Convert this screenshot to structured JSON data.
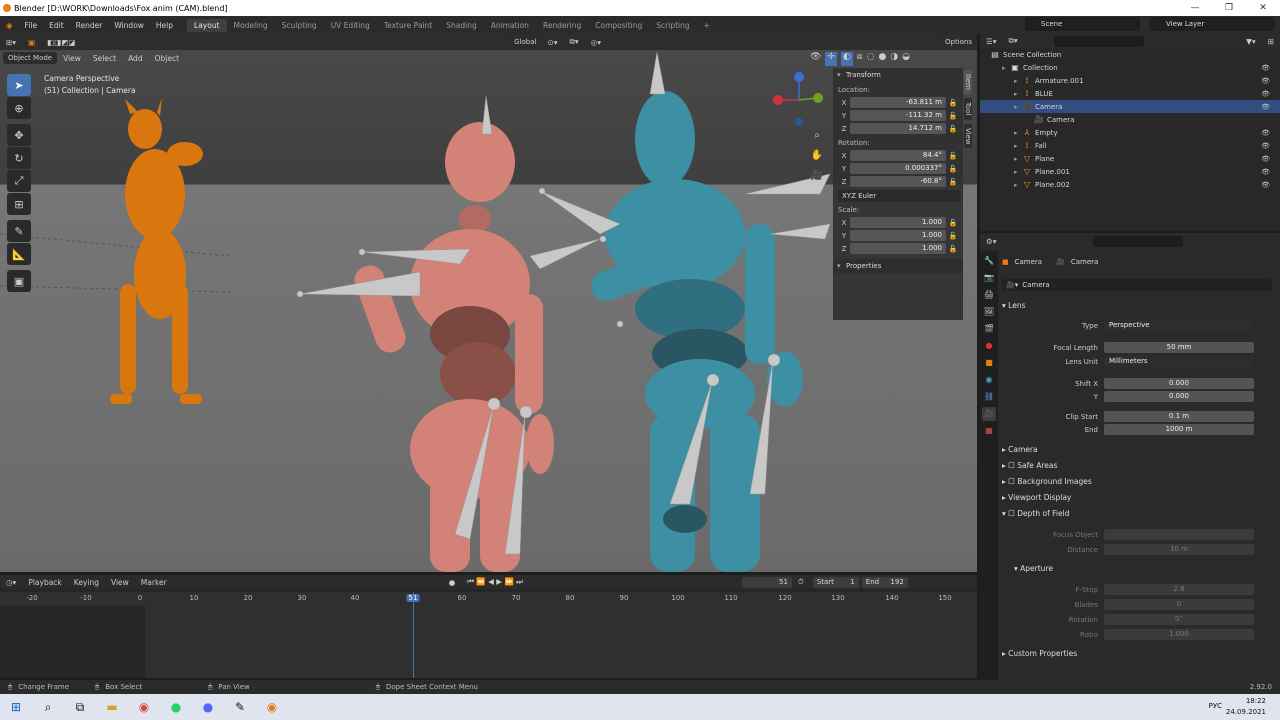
{
  "window": {
    "title": "Blender [D:\\WORK\\Downloads\\Fox anim (CAM).blend]"
  },
  "menu": {
    "file": "File",
    "edit": "Edit",
    "render": "Render",
    "window": "Window",
    "help": "Help"
  },
  "workspaces": [
    "Layout",
    "Modeling",
    "Sculpting",
    "UV Editing",
    "Texture Paint",
    "Shading",
    "Animation",
    "Rendering",
    "Compositing",
    "Scripting"
  ],
  "scene": "Scene",
  "view_layer": "View Layer",
  "viewport": {
    "mode": "Object Mode",
    "menus": [
      "View",
      "Select",
      "Add",
      "Object"
    ],
    "transform_orientation": "Global",
    "options": "Options",
    "info_line1": "Camera Perspective",
    "info_line2": "(51) Collection | Camera"
  },
  "npanel": {
    "transform": "Transform",
    "location_label": "Location:",
    "location": {
      "x": "-63.811 m",
      "y": "-111.32 m",
      "z": "14.712 m"
    },
    "rotation_label": "Rotation:",
    "rotation": {
      "x": "84.4°",
      "y": "0.000337°",
      "z": "-60.8°"
    },
    "rotation_mode": "XYZ Euler",
    "scale_label": "Scale:",
    "scale": {
      "x": "1.000",
      "y": "1.000",
      "z": "1.000"
    },
    "properties": "Properties",
    "tabs": [
      "Item",
      "Tool",
      "View"
    ]
  },
  "timeline": {
    "menus": [
      "Playback",
      "Keying",
      "View",
      "Marker"
    ],
    "current_frame": "51",
    "start_label": "Start",
    "start": "1",
    "end_label": "End",
    "end": "192",
    "ticks": [
      "-20",
      "-10",
      "0",
      "10",
      "20",
      "30",
      "40",
      "51",
      "60",
      "70",
      "80",
      "90",
      "100",
      "110",
      "120",
      "130",
      "140",
      "150"
    ]
  },
  "status": {
    "change_frame": "Change Frame",
    "box_select": "Box Select",
    "pan_view": "Pan View",
    "context_menu": "Dope Sheet Context Menu",
    "version": "2.92.0"
  },
  "outliner": {
    "scene_collection": "Scene Collection",
    "items": [
      {
        "name": "Collection",
        "icon": "collection-icon",
        "indent": 1
      },
      {
        "name": "Armature.001",
        "icon": "armature-icon",
        "indent": 2
      },
      {
        "name": "BLUE",
        "icon": "armature-icon",
        "indent": 2
      },
      {
        "name": "Camera",
        "icon": "camera-icon",
        "indent": 2,
        "selected": true
      },
      {
        "name": "Camera",
        "icon": "camera-data-icon",
        "indent": 3
      },
      {
        "name": "Empty",
        "icon": "empty-icon",
        "indent": 2
      },
      {
        "name": "Fall",
        "icon": "armature-icon",
        "indent": 2
      },
      {
        "name": "Plane",
        "icon": "mesh-icon",
        "indent": 2
      },
      {
        "name": "Plane.001",
        "icon": "mesh-icon",
        "indent": 2
      },
      {
        "name": "Plane.002",
        "icon": "mesh-icon",
        "indent": 2
      }
    ]
  },
  "properties": {
    "breadcrumb_object": "Camera",
    "breadcrumb_data": "Camera",
    "datablock": "Camera",
    "lens": "Lens",
    "type_label": "Type",
    "type": "Perspective",
    "focal_label": "Focal Length",
    "focal": "50 mm",
    "lens_unit_label": "Lens Unit",
    "lens_unit": "Millimeters",
    "shift_x_label": "Shift X",
    "shift_x": "0.000",
    "shift_y_label": "Y",
    "shift_y": "0.000",
    "clip_start_label": "Clip Start",
    "clip_start": "0.1 m",
    "clip_end_label": "End",
    "clip_end": "1000 m",
    "camera": "Camera",
    "safe_areas": "Safe Areas",
    "background_images": "Background Images",
    "viewport_display": "Viewport Display",
    "dof": "Depth of Field",
    "focus_object_label": "Focus Object",
    "distance_label": "Distance",
    "distance": "10 m",
    "aperture": "Aperture",
    "fstop_label": "F-Stop",
    "fstop": "2.8",
    "blades_label": "Blades",
    "blades": "0",
    "rotation_label": "Rotation",
    "rotation": "0°",
    "ratio_label": "Ratio",
    "ratio": "1.000",
    "custom_properties": "Custom Properties"
  },
  "taskbar": {
    "time": "18:22",
    "date": "24.09.2021",
    "lang": "РУС"
  }
}
